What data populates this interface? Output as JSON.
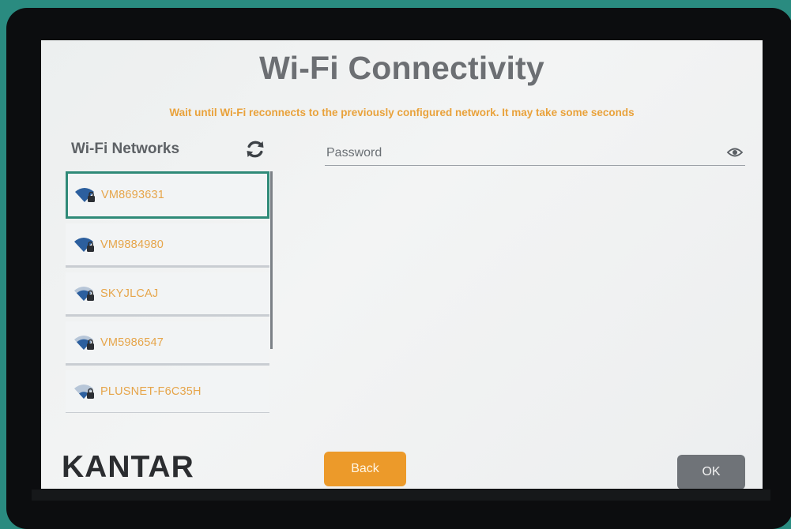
{
  "header": {
    "title": "Wi-Fi Connectivity",
    "subtitle": "Wait until Wi-Fi reconnects to the previously configured network. It may take some seconds"
  },
  "networks": {
    "label": "Wi-Fi Networks",
    "refresh_icon": "refresh-icon",
    "items": [
      {
        "ssid": "VM8693631",
        "signal": "strong",
        "secured": true,
        "selected": true
      },
      {
        "ssid": "VM9884980",
        "signal": "strong",
        "secured": true,
        "selected": false
      },
      {
        "ssid": "SKYJLCAJ",
        "signal": "medium",
        "secured": true,
        "selected": false
      },
      {
        "ssid": "VM5986547",
        "signal": "medium",
        "secured": true,
        "selected": false
      },
      {
        "ssid": "PLUSNET-F6C35H",
        "signal": "weak",
        "secured": true,
        "selected": false
      }
    ]
  },
  "password": {
    "placeholder": "Password",
    "value": "",
    "toggle_icon": "eye-icon"
  },
  "footer": {
    "logo": "KANTAR",
    "back_label": "Back",
    "ok_label": "OK"
  },
  "colors": {
    "accent_orange": "#ec9a2a",
    "selected_border": "#2f8a78",
    "wifi_blue": "#2c5f9e",
    "ok_gray": "#6f7378"
  }
}
